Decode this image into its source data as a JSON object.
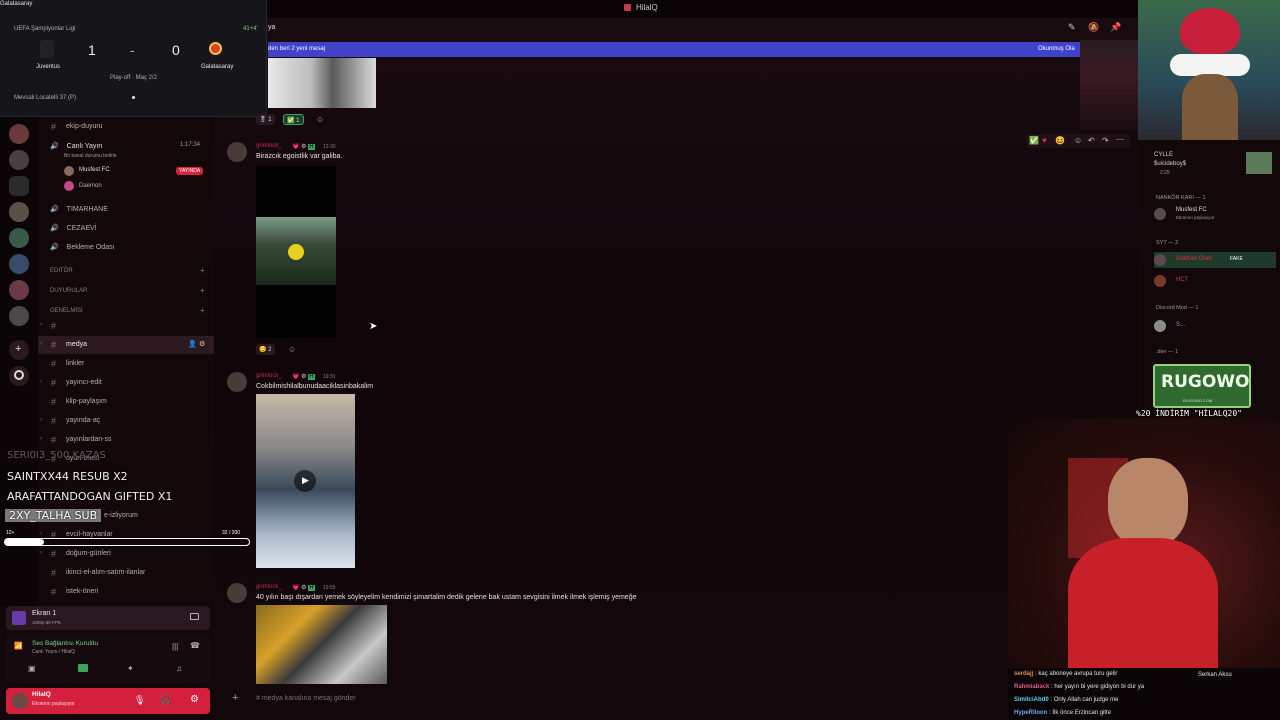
{
  "window": {
    "title": "HilalQ"
  },
  "score": {
    "top_label": "Galatasaray",
    "competition": "UEFA Şampiyonlar Ligi",
    "minute": "41+4'",
    "home_team": "Juventus",
    "home_score": "1",
    "separator": "-",
    "away_score": "0",
    "away_team": "Galatasaray",
    "stage": "Play-off · Maç 2/2",
    "footer": "Mevsali Locatelli 37 (P)",
    "colors": {
      "home": "#222222",
      "away": "#d6422e"
    }
  },
  "sidebar": {
    "channels_top": [
      {
        "name": "ekip-duyuru"
      }
    ],
    "live_voice": {
      "name": "Canlı Yayın",
      "elapsed": "1:17:34",
      "status": "Bir kanal durumu belirle",
      "members": [
        {
          "name": "Musfest FC",
          "badge": "YAYINDA"
        },
        {
          "name": "Daemon"
        }
      ]
    },
    "voice_channels": [
      "TIMARHANE",
      "CEZAEVİ",
      "Bekleme Odası"
    ],
    "categories": [
      "Editör",
      "DUYURULAR",
      "GENELMİSİ"
    ],
    "channels": [
      {
        "name": "",
        "expandable": true
      },
      {
        "name": "medya",
        "active": true,
        "expandable": true
      },
      {
        "name": "linkler"
      },
      {
        "name": "yayıncı-edit",
        "expandable": true
      },
      {
        "name": "klip-paylaşım"
      },
      {
        "name": "yayında-aç",
        "expandable": true
      },
      {
        "name": "yayınlardan-ss",
        "expandable": true
      },
      {
        "name": "oyun-önerİ",
        "expandable": true
      },
      {
        "name": "",
        "expandable": true
      },
      {
        "name": "e-izliyorum"
      },
      {
        "name": "evcil-hayvanlar",
        "expandable": true
      },
      {
        "name": "doğum-günleri",
        "expandable": true
      },
      {
        "name": "ikinci-el-alım-satım-ilanlar"
      },
      {
        "name": "istek-öneri"
      }
    ]
  },
  "alerts": {
    "faded": "SERI0I3_500 KAZAS",
    "lines": [
      "SAINTXX44 RESUB X2",
      "ARAFATTANDOGAN GIFTED X1",
      "2XY_TALHA SUB"
    ],
    "progress_label": "12+",
    "progress_value": "32 / 200",
    "progress_fraction": 0.16
  },
  "panel": {
    "screen": {
      "title": "Ekran 1",
      "sub": "1080p 60 FPS"
    },
    "voice": {
      "status": "Ses Bağlantısı Kuruldu",
      "sub": "Canlı Yayın / HilalQ"
    },
    "user": {
      "name": "HilalQ",
      "status": "Ekranını paylaşıyor"
    }
  },
  "main": {
    "channel_title": "medya",
    "banner": {
      "left": "den beri 2 yeni mesaj",
      "right": "Okunmuş Ola"
    },
    "reactions_top": [
      {
        "count": "1"
      },
      {
        "count": "1"
      }
    ],
    "messages": [
      {
        "user": "grimlock_",
        "time": "13:30",
        "text": "Birazcık egoistlik var galiba.",
        "reaction_count": "2"
      },
      {
        "user": "grimlock_",
        "time": "19:31",
        "text": "Cokbilmishilalbunudaaciklasinbakalim"
      },
      {
        "user": "grimlock_",
        "time": "19:55",
        "text": "40 yılın başı dışardan yemek söyleyelim kendimizi şimartalim dedik gelene bak ustam sevgisini ilmek ilmek işlemiş yemeğe"
      }
    ],
    "input_placeholder": "# medya kanalına mesaj gönder"
  },
  "members": {
    "top": {
      "name": "CYLLE",
      "activity": "$uicideboy$",
      "time": "2:25"
    },
    "groups": [
      {
        "title": "NANKÖR KARI — 1",
        "members": [
          {
            "name": "Musfest FC",
            "sub": "Ekranını paylaşıyor"
          }
        ]
      },
      {
        "title": "SYT — 2",
        "members": [
          {
            "name": "Gokhan Oner",
            "badge": "FAKE"
          },
          {
            "name": "HCT"
          }
        ]
      },
      {
        "title": "Discord Mod — 1",
        "members": [
          {
            "name": "S..."
          }
        ]
      },
      {
        "title": ".dev — 1",
        "members": []
      }
    ]
  },
  "overlay": {
    "rugowo": "RUGOWO",
    "rugowo_sub": "RUGOWO.COM",
    "promo": "%20 İNDİRİM \"HİLALQ20\""
  },
  "chat": {
    "lines": [
      {
        "user": "serdajj",
        "text": "kaç aboneye avrupa turu gelir"
      },
      {
        "user": "Rahmiaback",
        "text": "her yayın bi yere gidiyon bi dur ya"
      },
      {
        "user": "SimitciAbd0",
        "text": "Only Allah can judge me"
      },
      {
        "user": "HypeRiloon",
        "text": "İlk önce Erzincan gitte"
      }
    ],
    "side": [
      "Serkan Aksu"
    ]
  }
}
